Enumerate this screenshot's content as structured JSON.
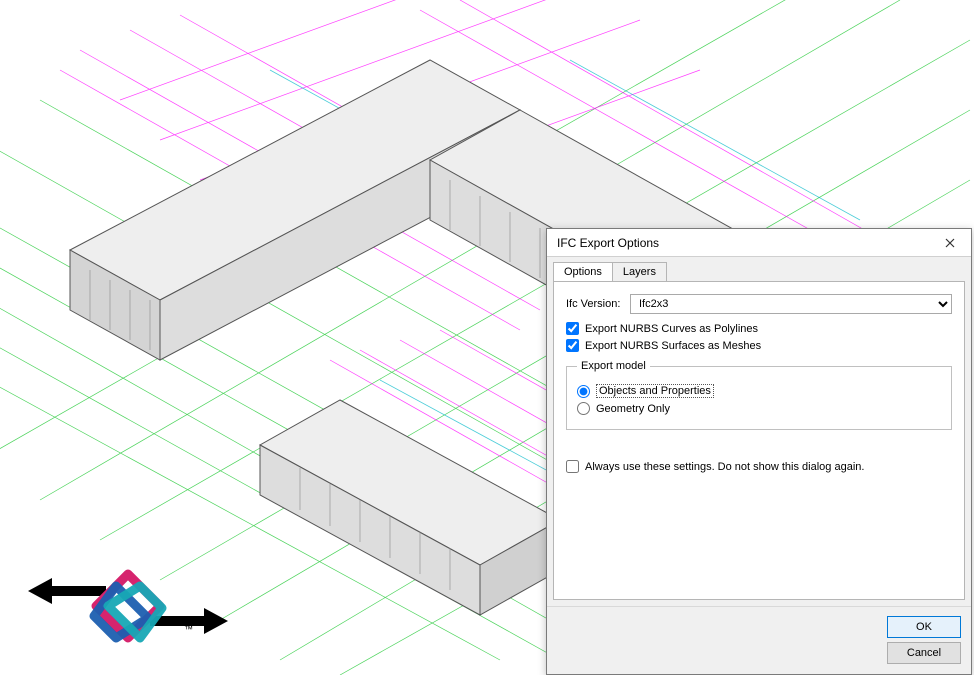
{
  "dialog": {
    "title": "IFC Export Options",
    "tabs": {
      "options": "Options",
      "layers": "Layers"
    },
    "ifc_version_label": "Ifc Version:",
    "ifc_version_value": "Ifc2x3",
    "chk_curves": "Export NURBS Curves as Polylines",
    "chk_surfaces": "Export NURBS Surfaces as Meshes",
    "group_label": "Export model",
    "radio_objects": "Objects and Properties",
    "radio_geometry": "Geometry Only",
    "always_label": "Always use these settings. Do not show this dialog again.",
    "ok": "OK",
    "cancel": "Cancel"
  },
  "logo": {
    "tm": "™"
  }
}
